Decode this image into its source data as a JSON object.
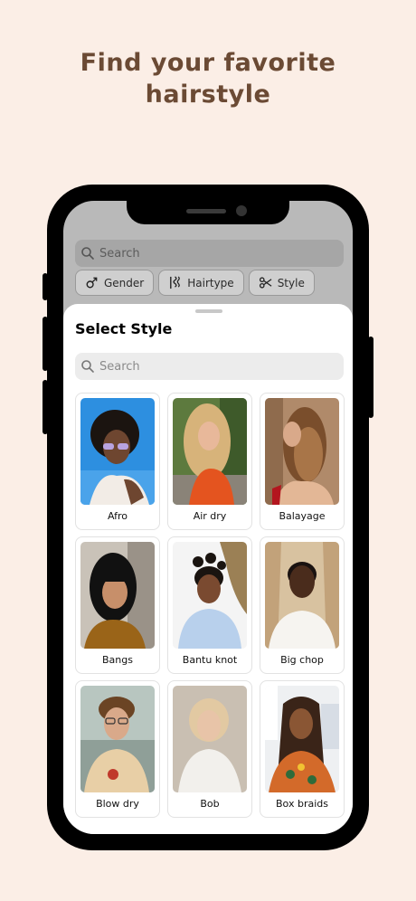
{
  "headline": {
    "line1": "Find your favorite",
    "line2": "hairstyle"
  },
  "background": {
    "search_placeholder": "Search",
    "chips": [
      {
        "label": "Gender",
        "icon": "gender-icon"
      },
      {
        "label": "Hairtype",
        "icon": "hairtype-icon"
      },
      {
        "label": "Style",
        "icon": "scissors-icon"
      }
    ]
  },
  "sheet": {
    "title": "Select Style",
    "search_placeholder": "Search",
    "styles": [
      {
        "label": "Afro"
      },
      {
        "label": "Air dry"
      },
      {
        "label": "Balayage"
      },
      {
        "label": "Bangs"
      },
      {
        "label": "Bantu knot"
      },
      {
        "label": "Big chop"
      },
      {
        "label": "Blow dry"
      },
      {
        "label": "Bob"
      },
      {
        "label": "Box braids"
      }
    ]
  },
  "colors": {
    "page_bg": "#fbeee6",
    "headline": "#6b4a34",
    "phone": "#000000",
    "sheet_bg": "#ffffff"
  }
}
